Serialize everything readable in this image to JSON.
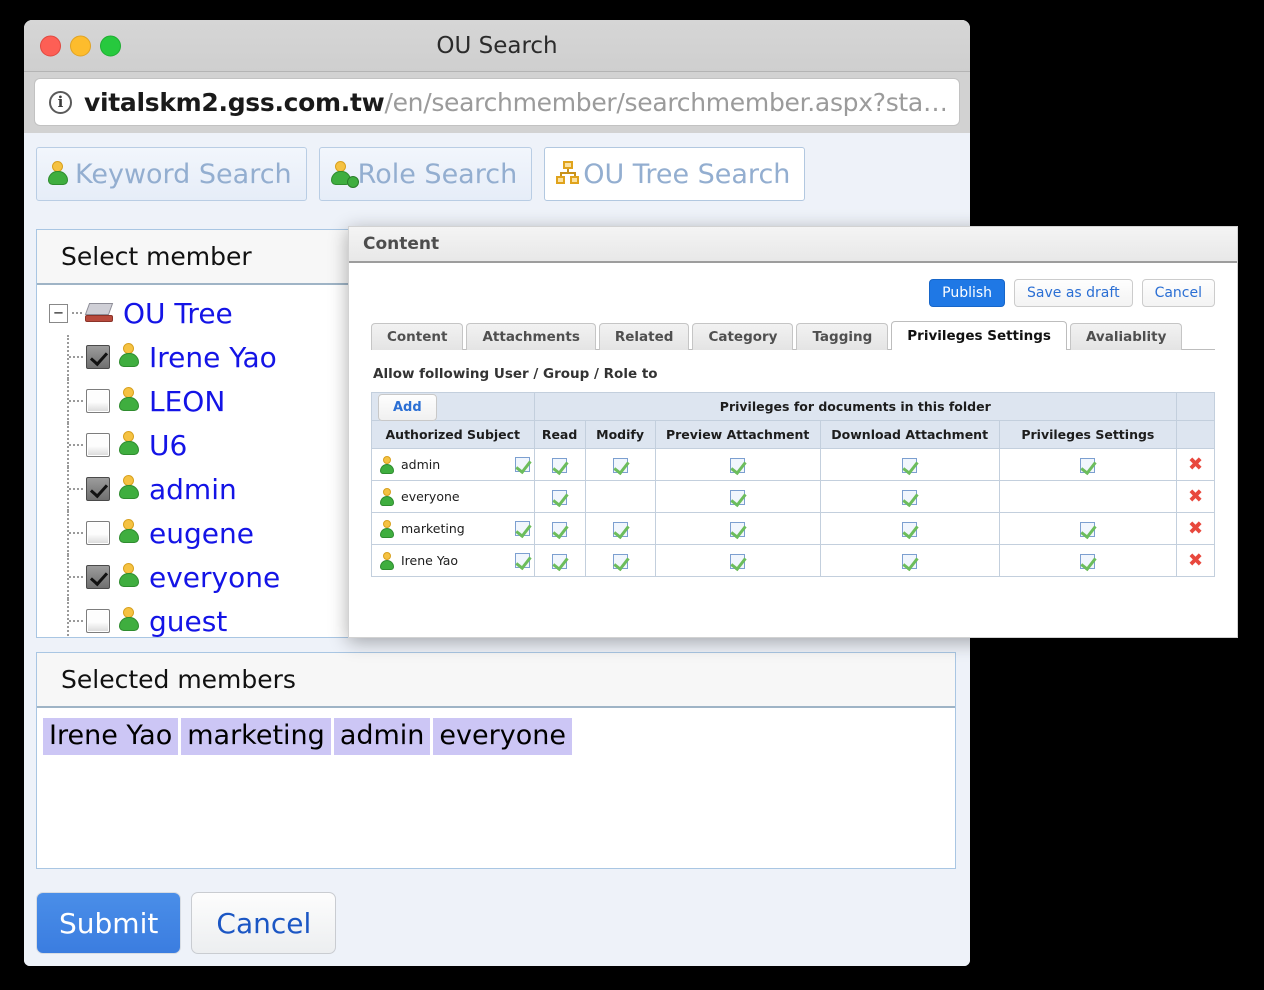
{
  "window": {
    "title": "OU Search",
    "traffic_lights": [
      "close-red",
      "minimize-yellow",
      "zoom-green"
    ]
  },
  "urlbar": {
    "info_icon": "info-icon",
    "host": "vitalskm2.gss.com.tw",
    "path": "/en/searchmember/searchmember.aspx?sta…"
  },
  "search_tabs": [
    {
      "label": "Keyword Search",
      "icon": "person-icon",
      "active": false
    },
    {
      "label": "Role Search",
      "icon": "person-plus-icon",
      "active": false
    },
    {
      "label": "OU Tree Search",
      "icon": "org-tree-icon",
      "active": true
    }
  ],
  "select_member_panel": {
    "title": "Select member",
    "tree": {
      "root_label": "OU Tree",
      "root_icon": "server-icon",
      "expander": "−",
      "items": [
        {
          "label": "Irene Yao",
          "checked": true
        },
        {
          "label": "LEON",
          "checked": false
        },
        {
          "label": "U6",
          "checked": false
        },
        {
          "label": "admin",
          "checked": true
        },
        {
          "label": "eugene",
          "checked": false
        },
        {
          "label": "everyone",
          "checked": true
        },
        {
          "label": "guest",
          "checked": false
        }
      ]
    }
  },
  "selected_members_panel": {
    "title": "Selected members",
    "chips": [
      "Irene Yao",
      "marketing",
      "admin",
      "everyone"
    ]
  },
  "footer": {
    "submit_label": "Submit",
    "cancel_label": "Cancel"
  },
  "content_dialog": {
    "header": "Content",
    "actions": {
      "publish": "Publish",
      "save_as_draft": "Save as draft",
      "cancel": "Cancel"
    },
    "tabs": [
      {
        "label": "Content",
        "active": false
      },
      {
        "label": "Attachments",
        "active": false
      },
      {
        "label": "Related",
        "active": false
      },
      {
        "label": "Category",
        "active": false
      },
      {
        "label": "Tagging",
        "active": false
      },
      {
        "label": "Privileges Settings",
        "active": true
      },
      {
        "label": "Avaliablity",
        "active": false
      }
    ],
    "caption": "Allow following User / Group / Role to",
    "add_button": "Add",
    "group_header": "Privileges for documents in this folder",
    "columns": [
      "Authorized Subject",
      "Read",
      "Modify",
      "Preview Attachment",
      "Download Attachment",
      "Privileges Settings"
    ],
    "rows": [
      {
        "subject": "admin",
        "subject_checked": true,
        "read": true,
        "modify": true,
        "preview_attachment": true,
        "download_attachment": true,
        "privileges_settings": true,
        "delete_icon": "✖"
      },
      {
        "subject": "everyone",
        "subject_checked": false,
        "read": true,
        "modify": false,
        "preview_attachment": true,
        "download_attachment": true,
        "privileges_settings": false,
        "delete_icon": "✖"
      },
      {
        "subject": "marketing",
        "subject_checked": true,
        "read": true,
        "modify": true,
        "preview_attachment": true,
        "download_attachment": true,
        "privileges_settings": true,
        "delete_icon": "✖"
      },
      {
        "subject": "Irene Yao",
        "subject_checked": true,
        "read": true,
        "modify": true,
        "preview_attachment": true,
        "download_attachment": true,
        "privileges_settings": true,
        "delete_icon": "✖"
      }
    ]
  },
  "colors": {
    "page_background": "#eef2f9",
    "accent_blue": "#1f78e5",
    "link_blue": "#1414e6",
    "chip_purple": "#ccc6f5",
    "table_header": "#dde5f0",
    "delete_red": "#e8483d",
    "check_green": "#6cbd5c"
  }
}
